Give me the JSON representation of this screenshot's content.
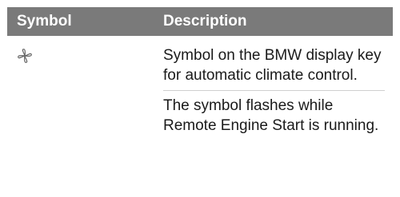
{
  "table": {
    "headers": {
      "symbol": "Symbol",
      "description": "Description"
    },
    "row": {
      "icon": "fan-icon",
      "paragraphs": [
        "Symbol on the BMW display key for automatic climate control.",
        "The symbol flashes while Remote Engine Start is running."
      ]
    }
  }
}
